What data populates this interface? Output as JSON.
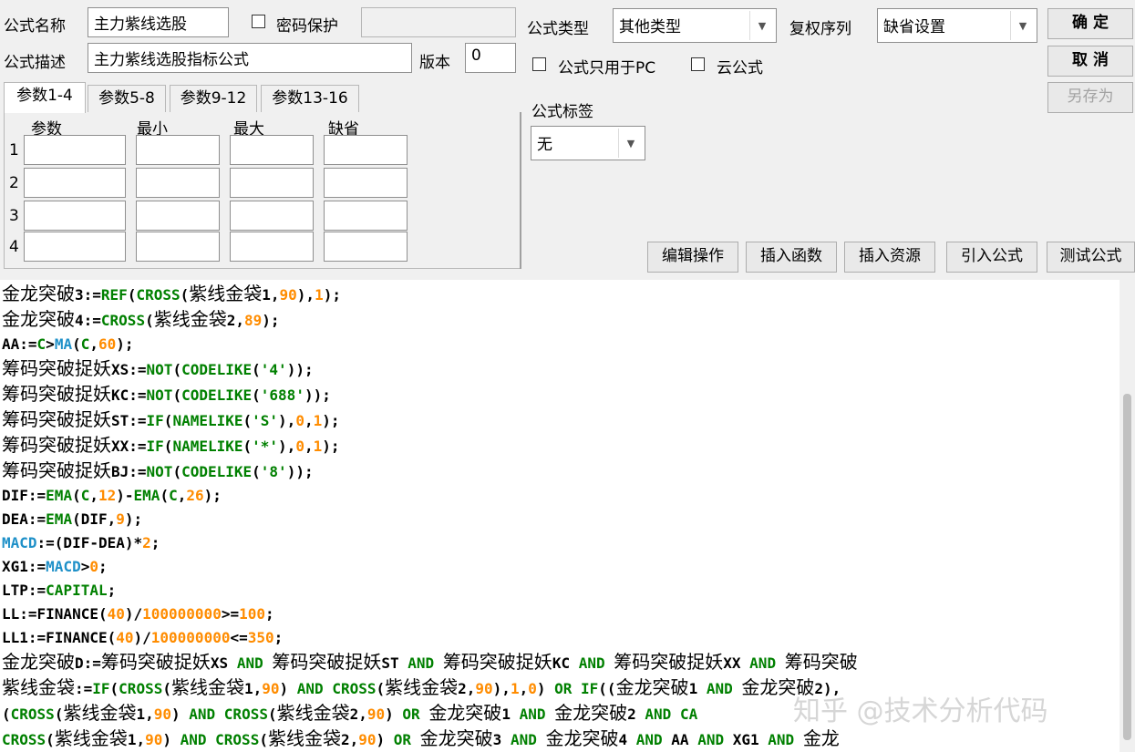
{
  "header": {
    "name_label": "公式名称",
    "name_value": "主力紫线选股",
    "password_label": "密码保护",
    "password_value": "",
    "desc_label": "公式描述",
    "desc_value": "主力紫线选股指标公式",
    "version_label": "版本",
    "version_value": "0",
    "type_label": "公式类型",
    "type_value": "其他类型",
    "adjust_label": "复权序列",
    "adjust_value": "缺省设置",
    "pc_only_label": "公式只用于PC",
    "cloud_label": "云公式",
    "tag_label": "公式标签",
    "tag_value": "无"
  },
  "buttons": {
    "ok": "确  定",
    "cancel": "取  消",
    "save_as": "另存为",
    "edit_ops": "编辑操作",
    "insert_func": "插入函数",
    "insert_res": "插入资源",
    "import_formula": "引入公式",
    "test_formula": "测试公式"
  },
  "params": {
    "tabs": [
      "参数1-4",
      "参数5-8",
      "参数9-12",
      "参数13-16"
    ],
    "columns": [
      "参数",
      "最小",
      "最大",
      "缺省"
    ],
    "rows": [
      "1",
      "2",
      "3",
      "4"
    ]
  },
  "code_lines": [
    [
      [
        "cn",
        "金龙突破"
      ],
      [
        "n",
        "3:="
      ],
      [
        "f",
        "REF"
      ],
      [
        "n",
        "("
      ],
      [
        "f",
        "CROSS"
      ],
      [
        "n",
        "("
      ],
      [
        "cn",
        "紫线金袋"
      ],
      [
        "n",
        "1,"
      ],
      [
        "num",
        "90"
      ],
      [
        "n",
        "),"
      ],
      [
        "num",
        "1"
      ],
      [
        "n",
        ");"
      ]
    ],
    [
      [
        "cn",
        "金龙突破"
      ],
      [
        "n",
        "4:="
      ],
      [
        "f",
        "CROSS"
      ],
      [
        "n",
        "("
      ],
      [
        "cn",
        "紫线金袋"
      ],
      [
        "n",
        "2,"
      ],
      [
        "num",
        "89"
      ],
      [
        "n",
        ");"
      ]
    ],
    [
      [
        "n",
        "AA:="
      ],
      [
        "f",
        "C"
      ],
      [
        "n",
        ">"
      ],
      [
        "m",
        "MA"
      ],
      [
        "n",
        "("
      ],
      [
        "f",
        "C"
      ],
      [
        "n",
        ","
      ],
      [
        "num",
        "60"
      ],
      [
        "n",
        ");"
      ]
    ],
    [
      [
        "cn",
        "筹码突破捉妖"
      ],
      [
        "n",
        "XS:="
      ],
      [
        "f",
        "NOT"
      ],
      [
        "n",
        "("
      ],
      [
        "f",
        "CODELIKE"
      ],
      [
        "n",
        "("
      ],
      [
        "s",
        "'4'"
      ],
      [
        "n",
        "));"
      ]
    ],
    [
      [
        "cn",
        "筹码突破捉妖"
      ],
      [
        "n",
        "KC:="
      ],
      [
        "f",
        "NOT"
      ],
      [
        "n",
        "("
      ],
      [
        "f",
        "CODELIKE"
      ],
      [
        "n",
        "("
      ],
      [
        "s",
        "'688'"
      ],
      [
        "n",
        "));"
      ]
    ],
    [
      [
        "cn",
        "筹码突破捉妖"
      ],
      [
        "n",
        "ST:="
      ],
      [
        "f",
        "IF"
      ],
      [
        "n",
        "("
      ],
      [
        "f",
        "NAMELIKE"
      ],
      [
        "n",
        "("
      ],
      [
        "s",
        "'S'"
      ],
      [
        "n",
        "),"
      ],
      [
        "num",
        "0"
      ],
      [
        "n",
        ","
      ],
      [
        "num",
        "1"
      ],
      [
        "n",
        ");"
      ]
    ],
    [
      [
        "cn",
        "筹码突破捉妖"
      ],
      [
        "n",
        "XX:="
      ],
      [
        "f",
        "IF"
      ],
      [
        "n",
        "("
      ],
      [
        "f",
        "NAMELIKE"
      ],
      [
        "n",
        "("
      ],
      [
        "s",
        "'*'"
      ],
      [
        "n",
        "),"
      ],
      [
        "num",
        "0"
      ],
      [
        "n",
        ","
      ],
      [
        "num",
        "1"
      ],
      [
        "n",
        ");"
      ]
    ],
    [
      [
        "cn",
        "筹码突破捉妖"
      ],
      [
        "n",
        "BJ:="
      ],
      [
        "f",
        "NOT"
      ],
      [
        "n",
        "("
      ],
      [
        "f",
        "CODELIKE"
      ],
      [
        "n",
        "("
      ],
      [
        "s",
        "'8'"
      ],
      [
        "n",
        "));"
      ]
    ],
    [
      [
        "n",
        "DIF:="
      ],
      [
        "f",
        "EMA"
      ],
      [
        "n",
        "("
      ],
      [
        "f",
        "C"
      ],
      [
        "n",
        ","
      ],
      [
        "num",
        "12"
      ],
      [
        "n",
        ")-"
      ],
      [
        "f",
        "EMA"
      ],
      [
        "n",
        "("
      ],
      [
        "f",
        "C"
      ],
      [
        "n",
        ","
      ],
      [
        "num",
        "26"
      ],
      [
        "n",
        ");"
      ]
    ],
    [
      [
        "n",
        "DEA:="
      ],
      [
        "f",
        "EMA"
      ],
      [
        "n",
        "(DIF,"
      ],
      [
        "num",
        "9"
      ],
      [
        "n",
        ");"
      ]
    ],
    [
      [
        "m",
        "MACD"
      ],
      [
        "n",
        ":=(DIF-DEA)*"
      ],
      [
        "num",
        "2"
      ],
      [
        "n",
        ";"
      ]
    ],
    [
      [
        "n",
        "XG1:="
      ],
      [
        "m",
        "MACD"
      ],
      [
        "n",
        ">"
      ],
      [
        "num",
        "0"
      ],
      [
        "n",
        ";"
      ]
    ],
    [
      [
        "n",
        "LTP:="
      ],
      [
        "f",
        "CAPITAL"
      ],
      [
        "n",
        ";"
      ]
    ],
    [
      [
        "n",
        "LL:=FINANCE("
      ],
      [
        "num",
        "40"
      ],
      [
        "n",
        ")/"
      ],
      [
        "num",
        "100000000"
      ],
      [
        "n",
        ">="
      ],
      [
        "num",
        "100"
      ],
      [
        "n",
        ";"
      ]
    ],
    [
      [
        "n",
        "LL1:=FINANCE("
      ],
      [
        "num",
        "40"
      ],
      [
        "n",
        ")/"
      ],
      [
        "num",
        "100000000"
      ],
      [
        "n",
        "<="
      ],
      [
        "num",
        "350"
      ],
      [
        "n",
        ";"
      ]
    ],
    [
      [
        "cn",
        "金龙突破"
      ],
      [
        "n",
        "D:="
      ],
      [
        "cn",
        "筹码突破捉妖"
      ],
      [
        "n",
        "XS "
      ],
      [
        "f",
        "AND"
      ],
      [
        "n",
        " "
      ],
      [
        "cn",
        "筹码突破捉妖"
      ],
      [
        "n",
        "ST "
      ],
      [
        "f",
        "AND"
      ],
      [
        "n",
        " "
      ],
      [
        "cn",
        "筹码突破捉妖"
      ],
      [
        "n",
        "KC "
      ],
      [
        "f",
        "AND"
      ],
      [
        "n",
        " "
      ],
      [
        "cn",
        "筹码突破捉妖"
      ],
      [
        "n",
        "XX "
      ],
      [
        "f",
        "AND"
      ],
      [
        "n",
        " "
      ],
      [
        "cn",
        "筹码突破"
      ]
    ],
    [
      [
        "cn",
        "紫线金袋"
      ],
      [
        "n",
        ":="
      ],
      [
        "f",
        "IF"
      ],
      [
        "n",
        "("
      ],
      [
        "f",
        "CROSS"
      ],
      [
        "n",
        "("
      ],
      [
        "cn",
        "紫线金袋"
      ],
      [
        "n",
        "1,"
      ],
      [
        "num",
        "90"
      ],
      [
        "n",
        ") "
      ],
      [
        "f",
        "AND"
      ],
      [
        "n",
        " "
      ],
      [
        "f",
        "CROSS"
      ],
      [
        "n",
        "("
      ],
      [
        "cn",
        "紫线金袋"
      ],
      [
        "n",
        "2,"
      ],
      [
        "num",
        "90"
      ],
      [
        "n",
        "),"
      ],
      [
        "num",
        "1"
      ],
      [
        "n",
        ","
      ],
      [
        "num",
        "0"
      ],
      [
        "n",
        ") "
      ],
      [
        "f",
        "OR"
      ],
      [
        "n",
        " "
      ],
      [
        "f",
        "IF"
      ],
      [
        "n",
        "(("
      ],
      [
        "cn",
        "金龙突破"
      ],
      [
        "n",
        "1 "
      ],
      [
        "f",
        "AND"
      ],
      [
        "n",
        " "
      ],
      [
        "cn",
        "金龙突破"
      ],
      [
        "n",
        "2),"
      ]
    ],
    [
      [
        "n",
        "("
      ],
      [
        "f",
        "CROSS"
      ],
      [
        "n",
        "("
      ],
      [
        "cn",
        "紫线金袋"
      ],
      [
        "n",
        "1,"
      ],
      [
        "num",
        "90"
      ],
      [
        "n",
        ") "
      ],
      [
        "f",
        "AND"
      ],
      [
        "n",
        " "
      ],
      [
        "f",
        "CROSS"
      ],
      [
        "n",
        "("
      ],
      [
        "cn",
        "紫线金袋"
      ],
      [
        "n",
        "2,"
      ],
      [
        "num",
        "90"
      ],
      [
        "n",
        ") "
      ],
      [
        "f",
        "OR"
      ],
      [
        "n",
        " "
      ],
      [
        "cn",
        "金龙突破"
      ],
      [
        "n",
        "1 "
      ],
      [
        "f",
        "AND"
      ],
      [
        "n",
        " "
      ],
      [
        "cn",
        "金龙突破"
      ],
      [
        "n",
        "2 "
      ],
      [
        "f",
        "AND"
      ],
      [
        "n",
        " "
      ],
      [
        "f",
        "CA"
      ]
    ],
    [
      [
        "f",
        "CROSS"
      ],
      [
        "n",
        "("
      ],
      [
        "cn",
        "紫线金袋"
      ],
      [
        "n",
        "1,"
      ],
      [
        "num",
        "90"
      ],
      [
        "n",
        ") "
      ],
      [
        "f",
        "AND"
      ],
      [
        "n",
        " "
      ],
      [
        "f",
        "CROSS"
      ],
      [
        "n",
        "("
      ],
      [
        "cn",
        "紫线金袋"
      ],
      [
        "n",
        "2,"
      ],
      [
        "num",
        "90"
      ],
      [
        "n",
        ") "
      ],
      [
        "f",
        "OR"
      ],
      [
        "n",
        " "
      ],
      [
        "cn",
        "金龙突破"
      ],
      [
        "n",
        "3 "
      ],
      [
        "f",
        "AND"
      ],
      [
        "n",
        " "
      ],
      [
        "cn",
        "金龙突破"
      ],
      [
        "n",
        "4 "
      ],
      [
        "f",
        "AND"
      ],
      [
        "n",
        " AA "
      ],
      [
        "f",
        "AND"
      ],
      [
        "n",
        " XG1 "
      ],
      [
        "f",
        "AND"
      ],
      [
        "n",
        " "
      ],
      [
        "cn",
        "金龙"
      ]
    ]
  ],
  "watermark": "知乎 @技术分析代码"
}
